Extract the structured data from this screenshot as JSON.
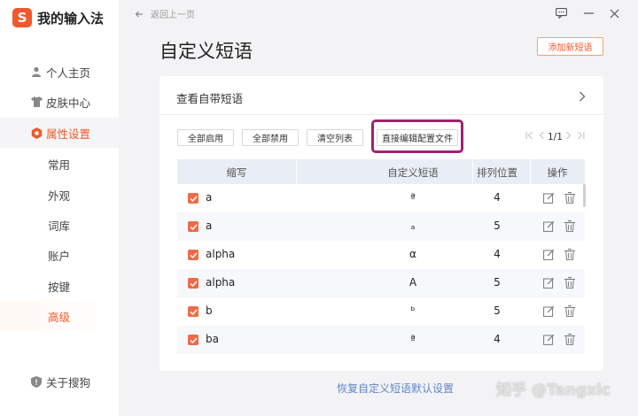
{
  "app": {
    "logo_glyph": "S",
    "title": "我的输入法",
    "accent": "#f2582b"
  },
  "sidebar": {
    "items": [
      {
        "label": "个人主页",
        "icon": "person-icon"
      },
      {
        "label": "皮肤中心",
        "icon": "shirt-icon"
      },
      {
        "label": "属性设置",
        "icon": "settings-icon"
      },
      {
        "label": "常用"
      },
      {
        "label": "外观"
      },
      {
        "label": "词库"
      },
      {
        "label": "账户"
      },
      {
        "label": "按键"
      },
      {
        "label": "高级"
      }
    ],
    "footer": {
      "label": "关于搜狗",
      "icon": "shield-icon"
    }
  },
  "topbar": {
    "back_label": "返回上一页"
  },
  "page": {
    "title": "自定义短语",
    "add_button": "添加新短语"
  },
  "panel": {
    "view_label": "查看自带短语",
    "toolbar": {
      "enable_all": "全部启用",
      "disable_all": "全部禁用",
      "clear_list": "清空列表",
      "edit_config": "直接编辑配置文件"
    },
    "pager": {
      "current": "1/1"
    },
    "table": {
      "headers": {
        "abbr": "缩写",
        "phrase": "自定义短语",
        "position": "排列位置",
        "actions": "操作"
      },
      "rows": [
        {
          "abbr": "a",
          "phrase": "ª",
          "position": "4"
        },
        {
          "abbr": "a",
          "phrase": "ₐ",
          "position": "5"
        },
        {
          "abbr": "alpha",
          "phrase": "α",
          "position": "4"
        },
        {
          "abbr": "alpha",
          "phrase": "Α",
          "position": "5"
        },
        {
          "abbr": "b",
          "phrase": "ᵇ",
          "position": "5"
        },
        {
          "abbr": "ba",
          "phrase": "ª",
          "position": "4"
        }
      ]
    }
  },
  "restore_link": "恢复自定义短语默认设置",
  "watermark": "知乎 @Tangxic"
}
